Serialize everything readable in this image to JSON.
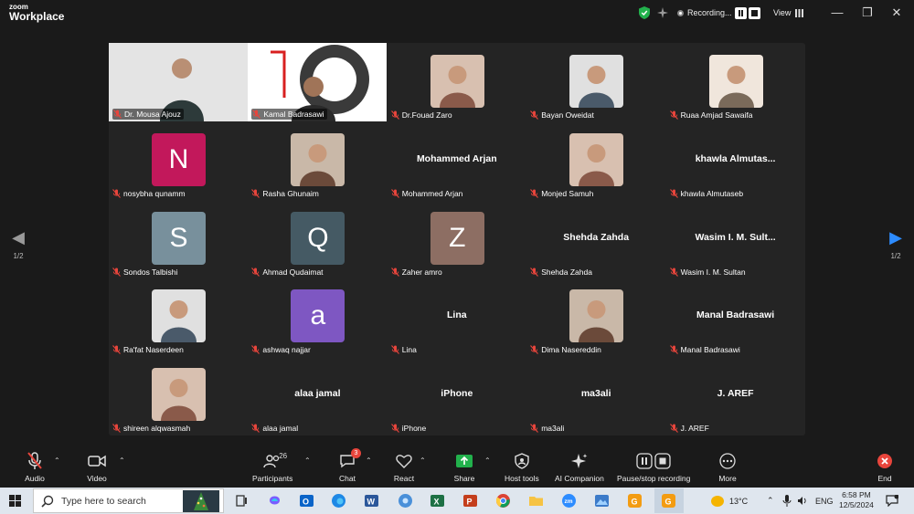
{
  "window": {
    "brand_top": "zoom",
    "brand_bottom": "Workplace",
    "recording_label": "Recording...",
    "view_label": "View",
    "minimize": "—",
    "restore": "❐",
    "close": "✕"
  },
  "gallery": {
    "tiles": [
      {
        "name": "Dr. Mousa Ajouz",
        "kind": "video",
        "active": true
      },
      {
        "name": "Kamal Badrasawi",
        "kind": "video"
      },
      {
        "name": "Dr.Fouad Zaro",
        "kind": "photo"
      },
      {
        "name": "Bayan Oweidat",
        "kind": "photo"
      },
      {
        "name": "Ruaa Amjad  Sawaifa",
        "kind": "photo"
      },
      {
        "name": "nosybha qunamm",
        "kind": "letter",
        "letter": "N",
        "color": "#c2185b"
      },
      {
        "name": "Rasha Ghunaim",
        "kind": "photo"
      },
      {
        "name": "Mohammed Arjan",
        "kind": "text",
        "display": "Mohammed Arjan"
      },
      {
        "name": "Monjed Samuh",
        "kind": "photo"
      },
      {
        "name": "khawla Almutaseb",
        "kind": "text",
        "display": "khawla  Almutas..."
      },
      {
        "name": "Sondos Talbishi",
        "kind": "letter",
        "letter": "S",
        "color": "#78909c"
      },
      {
        "name": "Ahmad Qudaimat",
        "kind": "letter",
        "letter": "Q",
        "color": "#455a64"
      },
      {
        "name": "Zaher amro",
        "kind": "letter",
        "letter": "Z",
        "color": "#8d6e63"
      },
      {
        "name": "Shehda Zahda",
        "kind": "text",
        "display": "Shehda Zahda"
      },
      {
        "name": "Wasim I. M. Sultan",
        "kind": "text",
        "display": "Wasim  I.  M.  Sult..."
      },
      {
        "name": "Ra'fat Naserdeen",
        "kind": "photo"
      },
      {
        "name": "ashwaq najjar",
        "kind": "letter",
        "letter": "a",
        "color": "#7e57c2"
      },
      {
        "name": "Lina",
        "kind": "text",
        "display": "Lina"
      },
      {
        "name": "Dima Nasereddin",
        "kind": "photo"
      },
      {
        "name": "Manal Badrasawi",
        "kind": "text",
        "display": "Manal Badrasawi"
      },
      {
        "name": "shireen alqwasmah",
        "kind": "photo"
      },
      {
        "name": "alaa jamal",
        "kind": "text",
        "display": "alaa jamal"
      },
      {
        "name": "iPhone",
        "kind": "text",
        "display": "iPhone"
      },
      {
        "name": "ma3ali",
        "kind": "text",
        "display": "ma3ali"
      },
      {
        "name": "J. AREF",
        "kind": "text",
        "display": "J. AREF"
      }
    ],
    "page_left": "1/2",
    "page_right": "1/2"
  },
  "toolbar": {
    "audio": "Audio",
    "video": "Video",
    "participants": "Participants",
    "participants_count": "26",
    "chat": "Chat",
    "chat_badge": "3",
    "react": "React",
    "share": "Share",
    "host_tools": "Host tools",
    "ai_companion": "AI Companion",
    "pause_stop": "Pause/stop recording",
    "more": "More",
    "end": "End"
  },
  "taskbar": {
    "search_placeholder": "Type here to search",
    "temperature": "13°C",
    "language": "ENG",
    "time": "6:58 PM",
    "date": "12/5/2024"
  },
  "colors": {
    "accent_green": "#2ecf5a",
    "end_red": "#e8453c",
    "share_green": "#22b14c"
  }
}
